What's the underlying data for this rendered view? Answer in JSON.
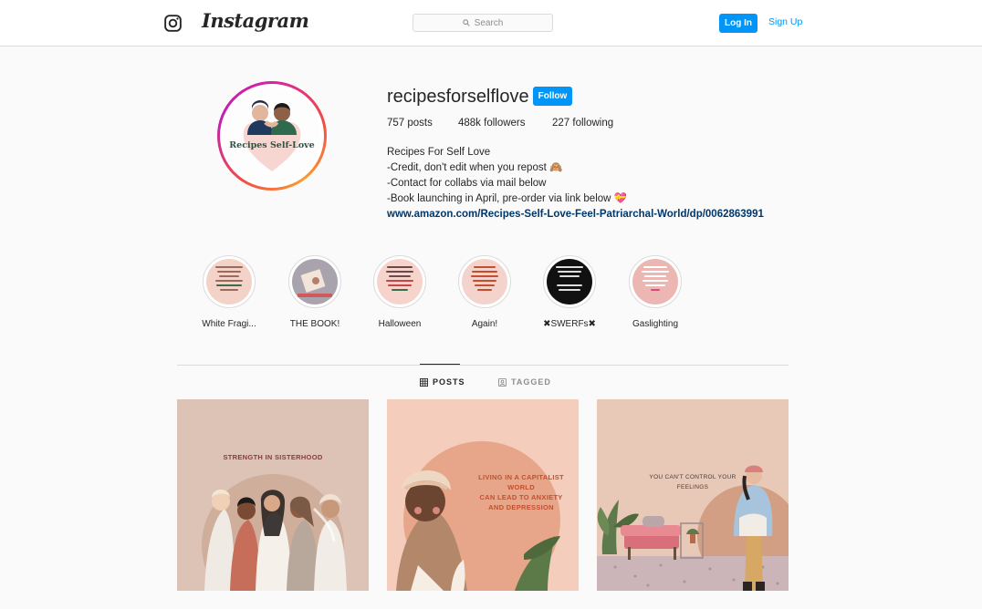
{
  "header": {
    "wordmark": "Instagram",
    "search_placeholder": "Search",
    "login_label": "Log In",
    "signup_label": "Sign Up",
    "icons": [
      "instagram-glyph-icon",
      "search-icon"
    ]
  },
  "profile": {
    "username": "recipesforselflove",
    "follow_label": "Follow",
    "avatar_text": "Recipes Self-Love",
    "stats": {
      "posts": "757 posts",
      "followers": "488k followers",
      "following": "227 following"
    },
    "bio": {
      "name": "Recipes For Self Love",
      "lines": [
        "-Credit, don't edit when you repost 🙈",
        "-Contact for collabs via mail below",
        "-Book launching in April, pre-order via link below 💝"
      ],
      "link": "www.amazon.com/Recipes-Self-Love-Feel-Patriarchal-World/dp/0062863991"
    }
  },
  "highlights": [
    {
      "label": "White Fragi...",
      "bg": "#f3d2c8"
    },
    {
      "label": "THE BOOK!",
      "bg": "#a9a3ad"
    },
    {
      "label": "Halloween",
      "bg": "#f6d4cc"
    },
    {
      "label": "Again!",
      "bg": "#f4d3cc"
    },
    {
      "label": "✖SWERFs✖",
      "bg": "#111111"
    },
    {
      "label": "Gaslighting",
      "bg": "#ecb7b3"
    }
  ],
  "tabs": {
    "posts_label": "POSTS",
    "tagged_label": "TAGGED",
    "active": "POSTS"
  },
  "posts": [
    {
      "caption_lines": [
        "STRENGTH IN SISTERHOOD"
      ],
      "bg": "#dcc3b5",
      "caption_color": "#8d3a3a"
    },
    {
      "caption_lines": [
        "LIVING IN A CAPITALIST WORLD",
        "CAN LEAD TO ANXIETY",
        "AND DEPRESSION"
      ],
      "bg": "#f5cdbd",
      "caption_color": "#c2502f"
    },
    {
      "caption_lines": [
        "YOU CAN'T CONTROL YOUR FEELINGS"
      ],
      "bg": "#e8c9b8",
      "caption_color": "#4a3a3a"
    }
  ],
  "colors": {
    "accent": "#0095f6",
    "link": "#00376b",
    "border": "#dbdbdb",
    "background": "#fafafa"
  }
}
